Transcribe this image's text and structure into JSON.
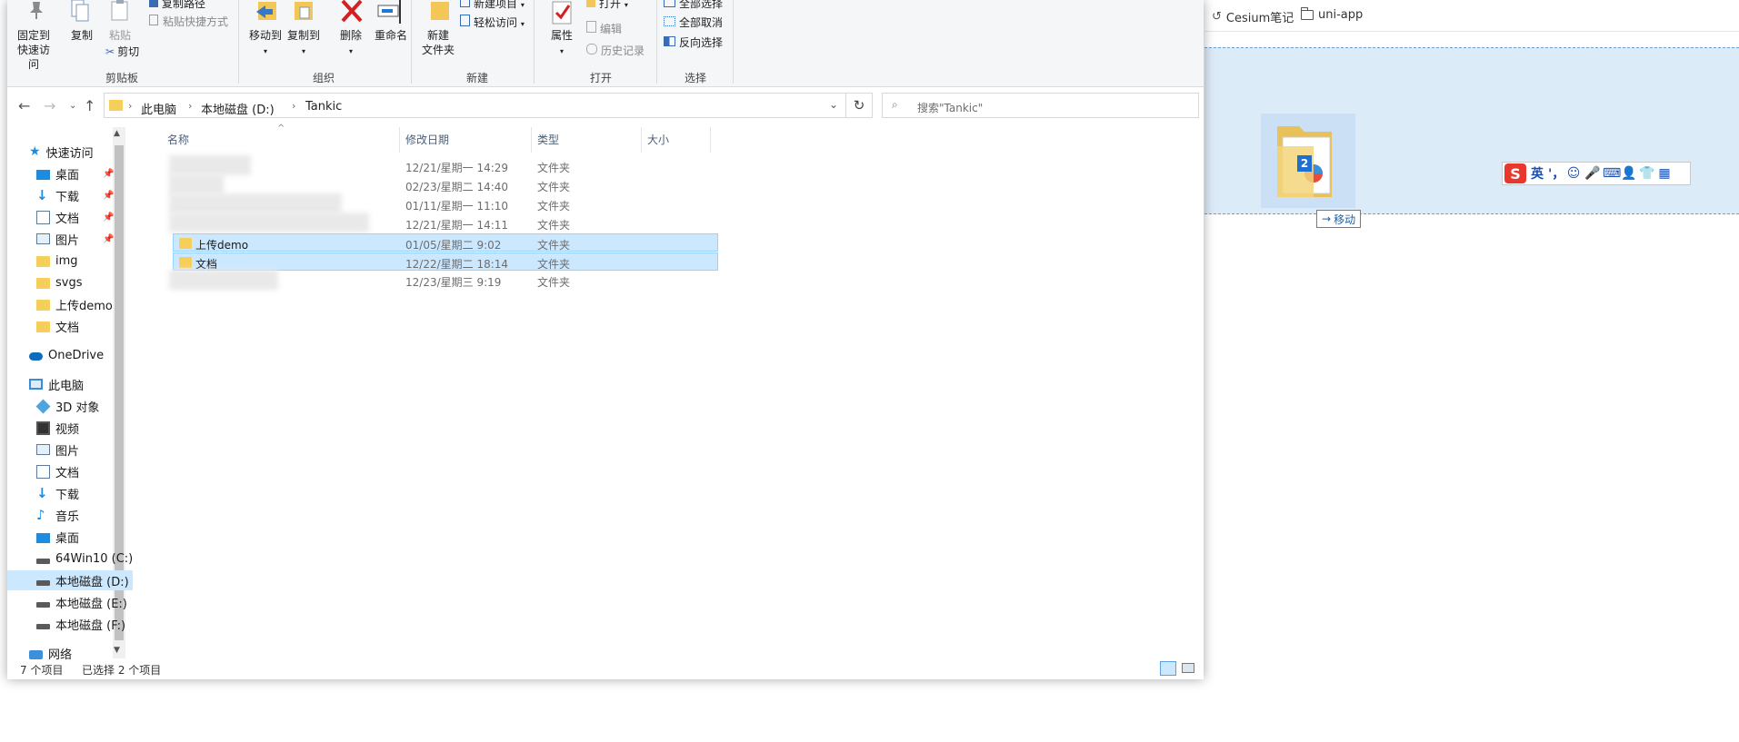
{
  "browser": {
    "bookmarks": [
      "Cesium笔记",
      "uni-app"
    ],
    "drag_badge": "2",
    "move_tooltip": "移动",
    "ime": {
      "logo": "S",
      "mode": "英",
      "buttons": [
        "'，",
        "☺",
        "🎤",
        "⌨",
        "👤",
        "👕",
        "▦"
      ]
    }
  },
  "ribbon": {
    "clipboard": {
      "label": "剪贴板",
      "pin": "固定到快速访问",
      "copy": "复制",
      "paste": "粘贴",
      "copy_path": "复制路径",
      "paste_shortcut": "粘贴快捷方式",
      "cut": "剪切"
    },
    "organize": {
      "label": "组织",
      "move_to": "移动到",
      "copy_to": "复制到",
      "delete": "删除",
      "rename": "重命名"
    },
    "new": {
      "label": "新建",
      "new_folder": "新建\n文件夹",
      "new_item": "新建项目",
      "easy_access": "轻松访问"
    },
    "open": {
      "label": "打开",
      "properties": "属性",
      "open": "打开",
      "edit": "编辑",
      "history": "历史记录"
    },
    "select": {
      "label": "选择",
      "select_all": "全部选择",
      "select_none": "全部取消",
      "invert": "反向选择"
    }
  },
  "address": {
    "crumbs": [
      "此电脑",
      "本地磁盘 (D:)",
      "Tankic"
    ],
    "search_placeholder": "搜索\"Tankic\""
  },
  "nav": {
    "quick_access": "快速访问",
    "quick_items": [
      "桌面",
      "下载",
      "文档",
      "图片",
      "img",
      "svgs",
      "上传demo",
      "文档"
    ],
    "onedrive": "OneDrive",
    "this_pc": "此电脑",
    "pc_items": [
      "3D 对象",
      "视频",
      "图片",
      "文档",
      "下载",
      "音乐",
      "桌面",
      "64Win10 (C:)",
      "本地磁盘 (D:)",
      "本地磁盘 (E:)",
      "本地磁盘 (F:)"
    ],
    "network": "网络"
  },
  "list": {
    "columns": {
      "name": "名称",
      "modified": "修改日期",
      "type": "类型",
      "size": "大小"
    },
    "rows": [
      {
        "name": "",
        "modified": "12/21/星期一 14:29",
        "type": "文件夹",
        "selected": false
      },
      {
        "name": "",
        "modified": "02/23/星期二 14:40",
        "type": "文件夹",
        "selected": false
      },
      {
        "name": "",
        "modified": "01/11/星期一 11:10",
        "type": "文件夹",
        "selected": false
      },
      {
        "name": "",
        "modified": "12/21/星期一 14:11",
        "type": "文件夹",
        "selected": false
      },
      {
        "name": "上传demo",
        "modified": "01/05/星期二 9:02",
        "type": "文件夹",
        "selected": true
      },
      {
        "name": "文档",
        "modified": "12/22/星期二 18:14",
        "type": "文件夹",
        "selected": true
      },
      {
        "name": "",
        "modified": "12/23/星期三 9:19",
        "type": "文件夹",
        "selected": false
      }
    ]
  },
  "status": {
    "count": "7 个项目",
    "selected": "已选择 2 个项目"
  }
}
